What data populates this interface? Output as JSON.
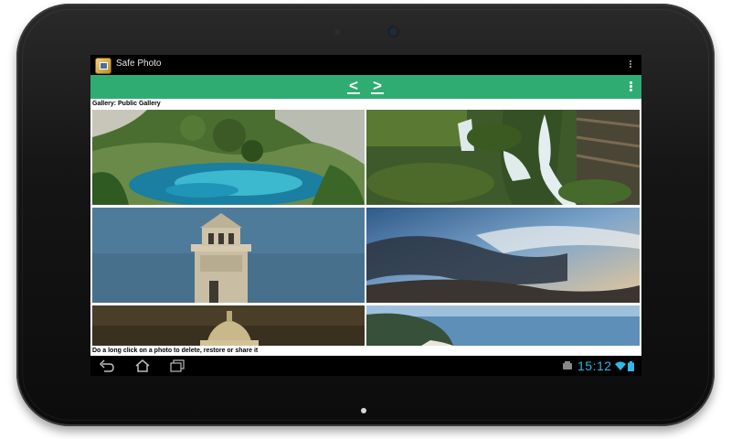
{
  "app": {
    "title": "Safe Photo",
    "icon": "safe-photo-app-icon"
  },
  "actionbar": {
    "prev_glyph": "<",
    "next_glyph": ">",
    "accent_color": "#2eac72"
  },
  "gallery": {
    "label": "Gallery:  Public Gallery"
  },
  "hint": "Do a long click on a photo to delete, restore or share it",
  "photos": [
    {
      "id": "photo-lake"
    },
    {
      "id": "photo-waterfall"
    },
    {
      "id": "photo-bell-tower"
    },
    {
      "id": "photo-cloudy-sky"
    },
    {
      "id": "photo-church-dome"
    },
    {
      "id": "photo-coastline"
    }
  ],
  "system": {
    "clock": "15:12",
    "clock_color": "#2fb8e8",
    "icons": [
      "back-icon",
      "home-icon",
      "recent-apps-icon",
      "storage-icon",
      "wifi-icon",
      "battery-icon"
    ]
  }
}
